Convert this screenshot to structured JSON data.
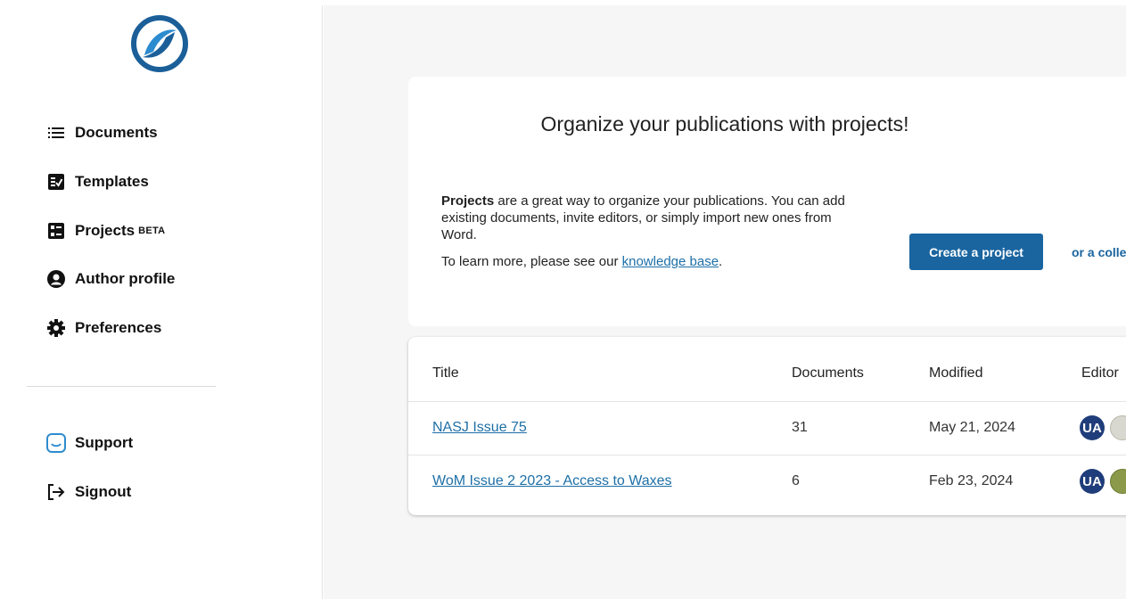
{
  "nav": {
    "items": [
      {
        "label": "Documents",
        "icon": "list-icon"
      },
      {
        "label": "Templates",
        "icon": "template-icon"
      },
      {
        "label": "Projects",
        "beta": "BETA",
        "icon": "projects-icon"
      },
      {
        "label": "Author profile",
        "icon": "user-circle-icon"
      },
      {
        "label": "Preferences",
        "icon": "gear-icon"
      }
    ],
    "bottom": [
      {
        "label": "Support",
        "icon": "chat-icon"
      },
      {
        "label": "Signout",
        "icon": "signout-icon"
      }
    ]
  },
  "promo": {
    "title": "Organize your publications with projects!",
    "bold_word": "Projects",
    "text_rest": " are a great way to organize your publications. You can add existing documents, invite editors, or simply import new ones from Word.",
    "learn_prefix": "To learn more, please see our ",
    "kb_link": "knowledge base",
    "learn_suffix": ".",
    "create_button": "Create a project",
    "collection_link": "or a colle"
  },
  "table": {
    "headers": {
      "title": "Title",
      "documents": "Documents",
      "modified": "Modified",
      "editors": "Editor"
    },
    "rows": [
      {
        "title": "NASJ Issue 75",
        "documents": "31",
        "modified": "May 21, 2024",
        "avatar": "UA"
      },
      {
        "title": "WoM Issue 2 2023 - Access to Waxes",
        "documents": "6",
        "modified": "Feb 23, 2024",
        "avatar": "UA"
      }
    ]
  },
  "colors": {
    "accent": "#1a65a0",
    "link": "#1d6fa8"
  }
}
